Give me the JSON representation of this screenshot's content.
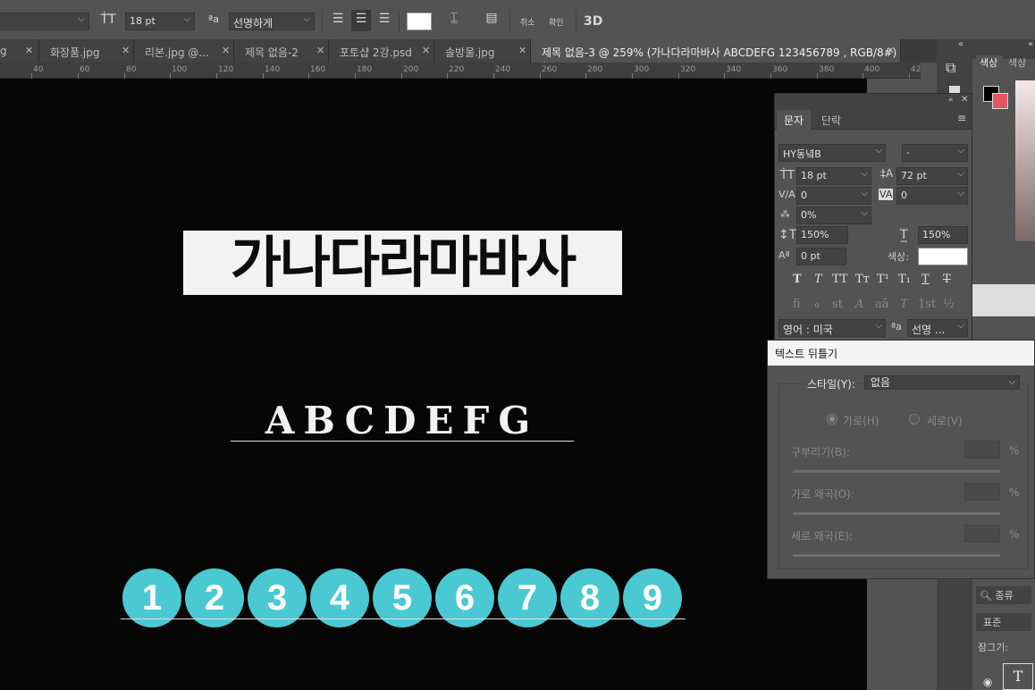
{
  "options_bar": {
    "font_size": "18 pt",
    "aa_label": "ªa",
    "anti_alias": "선명하게",
    "cancel_label": "취소",
    "commit_label": "확인",
    "three_d_label": "3D"
  },
  "tabs": [
    {
      "label": "g"
    },
    {
      "label": "화장품.jpg"
    },
    {
      "label": "리본.jpg @..."
    },
    {
      "label": "제목 없음-2"
    },
    {
      "label": "포토샵 2강.psd"
    },
    {
      "label": "솔방울.jpg"
    },
    {
      "label": "제목 없음-3 @ 259% (가나다라마바사 ABCDEFG 123456789 , RGB/8#) *"
    }
  ],
  "ruler": [
    "40",
    "60",
    "80",
    "100",
    "120",
    "140",
    "160",
    "180",
    "200",
    "220",
    "240",
    "260",
    "280",
    "300",
    "320",
    "340",
    "360",
    "380",
    "400",
    "42"
  ],
  "canvas": {
    "hangul_text": "가나다라마바사",
    "latin_text": "ABCDEFG",
    "numbers": [
      "1",
      "2",
      "3",
      "4",
      "5",
      "6",
      "7",
      "8",
      "9"
    ]
  },
  "character_panel": {
    "tab_character": "문자",
    "tab_paragraph": "단락",
    "font_family": "HY동녘B",
    "font_style": "-",
    "font_size": "18 pt",
    "leading": "72 pt",
    "kerning": "0",
    "tracking": "0",
    "tsume": "0%",
    "vertical_scale": "150%",
    "horizontal_scale": "150%",
    "baseline_shift": "0 pt",
    "color_label": "색상:",
    "language": "영어 : 미국",
    "aa_label": "ªa",
    "anti_alias": "선명 ...",
    "style_glyphs": [
      "T",
      "T",
      "TT",
      "Tт",
      "T¹",
      "T₁",
      "T",
      "T"
    ],
    "opentype_glyphs": [
      "fi",
      "ℴ",
      "st",
      "A",
      "aā",
      "T",
      "1st",
      "½"
    ]
  },
  "right_panel": {
    "color_tab": "색상",
    "color_tab2": "색상",
    "search_label": "종류",
    "blend_label": "표준",
    "lock_label": "잠그기:"
  },
  "warp_dialog": {
    "title": "텍스트 뒤틀기",
    "style_label": "스타일(Y):",
    "style_value": "없음",
    "horizontal": "가로(H)",
    "vertical": "세로(V)",
    "bend": "구부리기(B):",
    "h_distortion": "가로 왜곡(O):",
    "v_distortion": "세로 왜곡(E):",
    "percent": "%"
  },
  "colors": {
    "accent_cyan": "#4bc9d3",
    "canvas_bg": "#060606",
    "ui_bg": "#535353",
    "swatch_red": "#e0575f"
  }
}
